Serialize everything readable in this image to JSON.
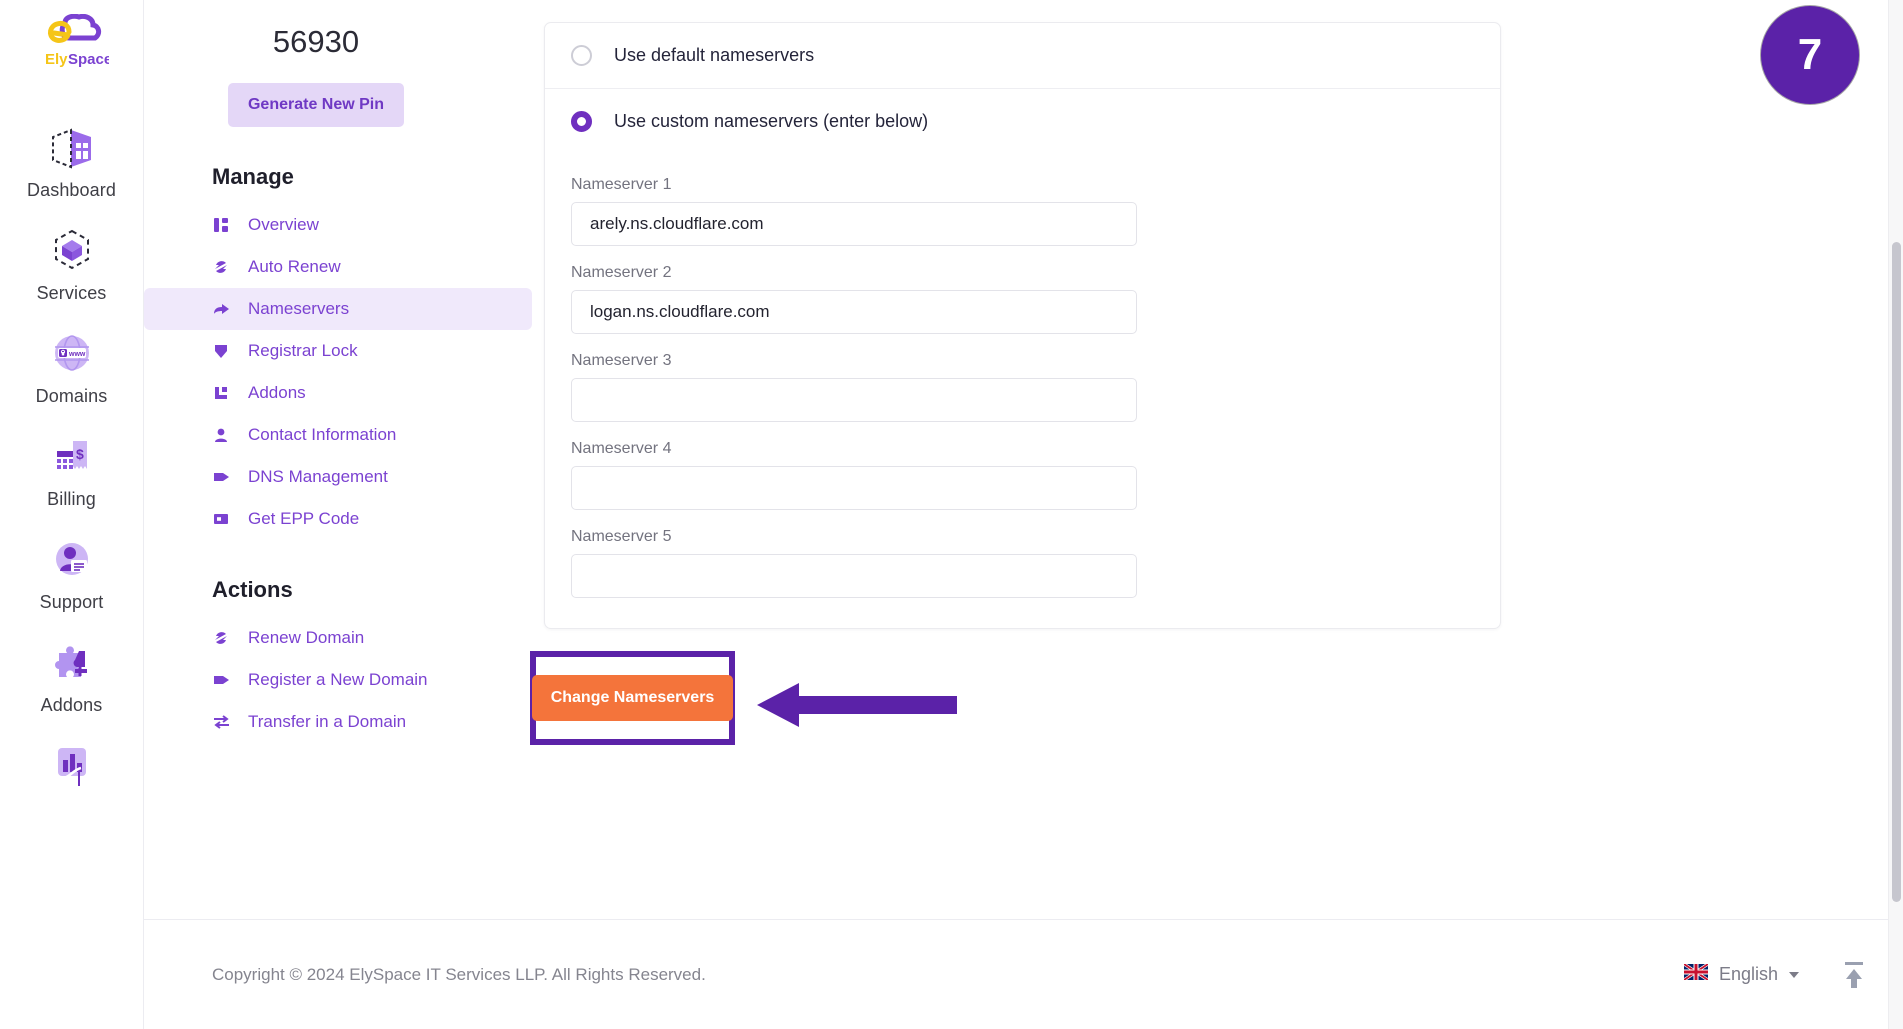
{
  "brand": {
    "name_primary": "Ely",
    "name_secondary": "Space",
    "colors": {
      "yellow": "#f5c518",
      "purple": "#7b42d1"
    }
  },
  "sidebar": {
    "items": [
      {
        "label": "Dashboard",
        "icon": "dashboard-icon"
      },
      {
        "label": "Services",
        "icon": "services-cube-icon"
      },
      {
        "label": "Domains",
        "icon": "domains-globe-icon"
      },
      {
        "label": "Billing",
        "icon": "billing-invoice-icon"
      },
      {
        "label": "Support",
        "icon": "support-agent-icon"
      },
      {
        "label": "Addons",
        "icon": "addons-puzzle-icon"
      },
      {
        "label": "",
        "icon": "reports-chart-icon"
      }
    ]
  },
  "pin": {
    "value": "56930",
    "button_label": "Generate New Pin"
  },
  "manage": {
    "title": "Manage",
    "items": [
      {
        "label": "Overview",
        "icon": "layout-icon",
        "active": false
      },
      {
        "label": "Auto Renew",
        "icon": "refresh-icon",
        "active": false
      },
      {
        "label": "Nameservers",
        "icon": "arrow-right-icon",
        "active": true
      },
      {
        "label": "Registrar Lock",
        "icon": "shield-icon",
        "active": false
      },
      {
        "label": "Addons",
        "icon": "blocks-icon",
        "active": false
      },
      {
        "label": "Contact Information",
        "icon": "user-icon",
        "active": false
      },
      {
        "label": "DNS Management",
        "icon": "tag-icon",
        "active": false
      },
      {
        "label": "Get EPP Code",
        "icon": "code-box-icon",
        "active": false
      }
    ]
  },
  "actions": {
    "title": "Actions",
    "items": [
      {
        "label": "Renew Domain",
        "icon": "refresh-icon"
      },
      {
        "label": "Register a New Domain",
        "icon": "tag-icon"
      },
      {
        "label": "Transfer in a Domain",
        "icon": "transfer-icon"
      }
    ]
  },
  "nameservers_card": {
    "options": [
      {
        "label": "Use default nameservers",
        "selected": false
      },
      {
        "label": "Use custom nameservers (enter below)",
        "selected": true
      }
    ],
    "fields": [
      {
        "label": "Nameserver 1",
        "value": "arely.ns.cloudflare.com",
        "placeholder": ""
      },
      {
        "label": "Nameserver 2",
        "value": "logan.ns.cloudflare.com",
        "placeholder": ""
      },
      {
        "label": "Nameserver 3",
        "value": "",
        "placeholder": ""
      },
      {
        "label": "Nameserver 4",
        "value": "",
        "placeholder": ""
      },
      {
        "label": "Nameserver 5",
        "value": "",
        "placeholder": ""
      }
    ],
    "submit_label": "Change Nameservers"
  },
  "annotation": {
    "step_number": "7",
    "highlight_color": "#5b22a8",
    "arrow_color": "#5b22a8",
    "button_color": "#f4743b"
  },
  "footer": {
    "copyright": "Copyright © 2024 ElySpace IT Services LLP. All Rights Reserved.",
    "language": "English",
    "flag": "uk-flag-icon",
    "scroll_top": "scroll-to-top-icon"
  }
}
